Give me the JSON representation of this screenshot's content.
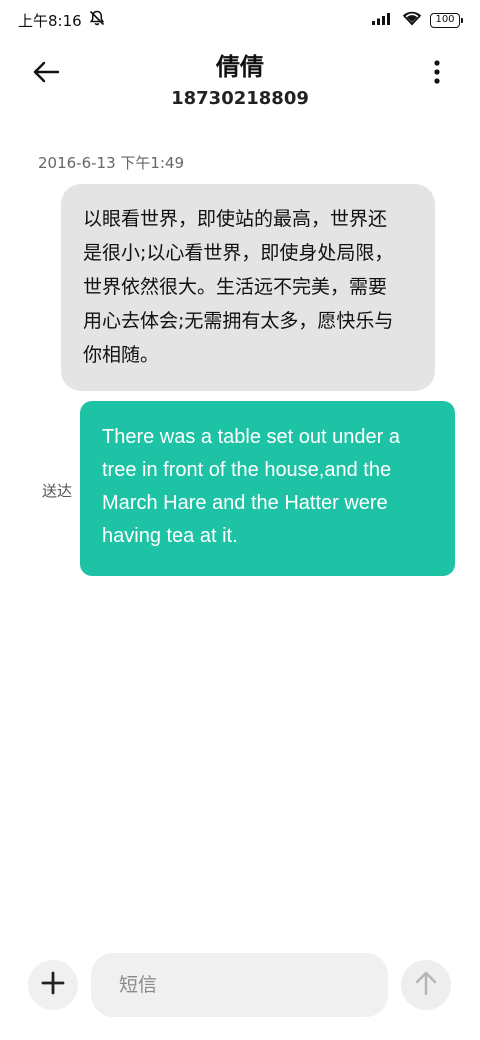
{
  "status_bar": {
    "time": "上午8:16",
    "battery": "100",
    "icons": [
      "mute-bell-icon",
      "signal-icon",
      "wifi-icon",
      "battery-icon"
    ]
  },
  "header": {
    "contact_name": "倩倩",
    "contact_number": "18730218809",
    "icons": [
      "back-arrow-icon",
      "more-vertical-icon"
    ]
  },
  "messages": {
    "timestamp": "2016-6-13 下午1:49",
    "incoming": {
      "lines": [
        "以眼看世界，即使站的最高，世界还",
        "是很小;以心看世界，即使身处局限，",
        "世界依然很大。生活远不完美，需要",
        "用心去体会;无需拥有太多，愿快乐与",
        "你相随。"
      ]
    },
    "outgoing": {
      "status": "送达",
      "lines": [
        "There was a table set out under a",
        "tree in front of the house,and the",
        "March Hare and the Hatter were",
        "having tea at it."
      ]
    }
  },
  "input_bar": {
    "placeholder": "短信",
    "value": "",
    "icons": [
      "plus-icon",
      "send-arrow-up-icon"
    ]
  },
  "colors": {
    "incoming_bubble": "#e4e4e4",
    "outgoing_bubble": "#1ec2a4",
    "background": "#ffffff"
  }
}
